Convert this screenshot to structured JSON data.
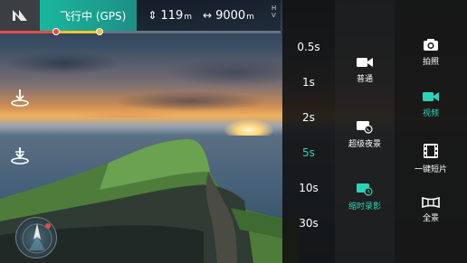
{
  "status": {
    "flight_mode": "飞行中 (GPS)",
    "altitude_value": "119",
    "altitude_unit": "m",
    "distance_value": "9000",
    "distance_unit": "m",
    "h_label": "H",
    "v_label": "V"
  },
  "seconds": [
    "0.5s",
    "1s",
    "2s",
    "5s",
    "10s",
    "30s"
  ],
  "selected_seconds": "5s",
  "modes": [
    {
      "label": "普通",
      "icon": "video-camera-icon"
    },
    {
      "label": "超级夜景",
      "icon": "night-camera-icon"
    },
    {
      "label": "缩时录影",
      "icon": "timelapse-icon"
    }
  ],
  "selected_mode": "缩时录影",
  "main_modes": [
    {
      "label": "拍照",
      "icon": "camera-icon"
    },
    {
      "label": "视频",
      "icon": "video-icon"
    },
    {
      "label": "一键短片",
      "icon": "film-icon"
    },
    {
      "label": "全景",
      "icon": "panorama-icon"
    }
  ],
  "selected_main": "视频",
  "colors": {
    "accent": "#2dd3b8",
    "status_bar": "#19b79e",
    "progress_red": "#e54b4b",
    "progress_yellow": "#f2c230"
  }
}
